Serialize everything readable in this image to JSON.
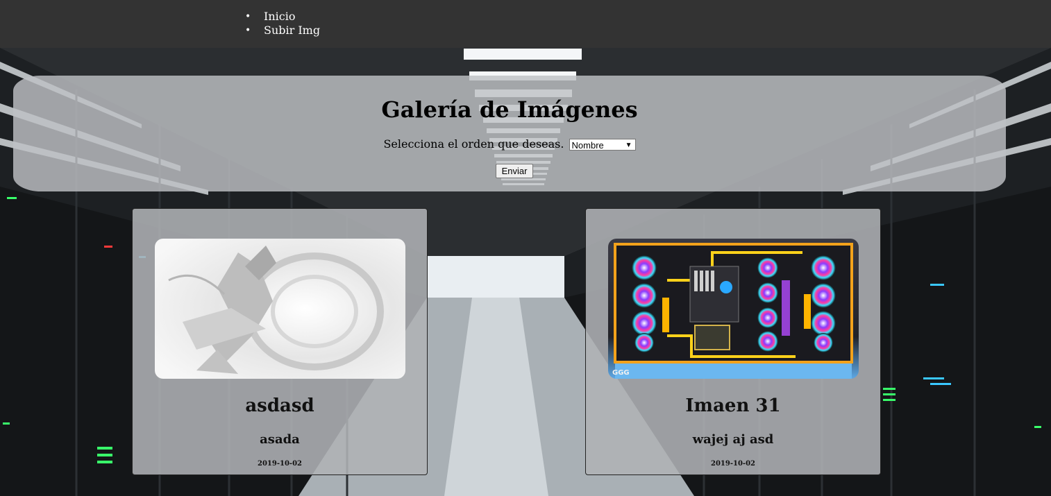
{
  "nav": {
    "items": [
      {
        "label": "Inicio"
      },
      {
        "label": "Subir Img"
      }
    ]
  },
  "header": {
    "title": "Galería de Imágenes",
    "order_prompt": "Selecciona el orden que deseas.",
    "order_select": {
      "selected": "Nombre"
    },
    "submit_label": "Enviar"
  },
  "gallery": {
    "cards": [
      {
        "title": "asdasd",
        "description": "asada",
        "date": "2019-10-02"
      },
      {
        "title": "Imaen 31",
        "description": "wajej aj asd",
        "date": "2019-10-02"
      }
    ]
  }
}
